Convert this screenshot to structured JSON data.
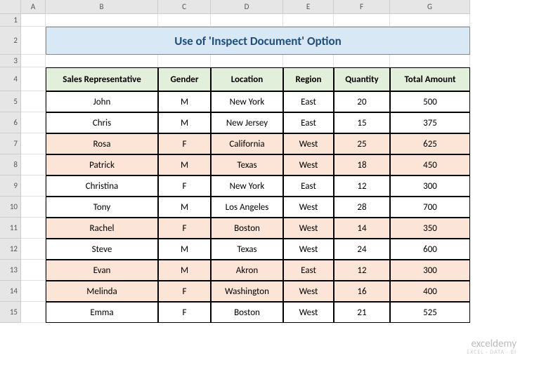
{
  "columns": [
    "A",
    "B",
    "C",
    "D",
    "E",
    "F",
    "G"
  ],
  "rows_visible": 15,
  "title": "Use of 'Inspect Document' Option",
  "chart_data": {
    "type": "table",
    "title": "Use of 'Inspect Document' Option",
    "headers": [
      "Sales Representative",
      "Gender",
      "Location",
      "Region",
      "Quantity",
      "Total Amount"
    ],
    "rows": [
      {
        "rep": "John",
        "gender": "M",
        "location": "New York",
        "region": "East",
        "quantity": 20,
        "total": 500,
        "highlight": false
      },
      {
        "rep": "Chris",
        "gender": "M",
        "location": "New Jersey",
        "region": "East",
        "quantity": 15,
        "total": 375,
        "highlight": false
      },
      {
        "rep": "Rosa",
        "gender": "F",
        "location": "California",
        "region": "West",
        "quantity": 25,
        "total": 625,
        "highlight": true
      },
      {
        "rep": "Patrick",
        "gender": "M",
        "location": "Texas",
        "region": "West",
        "quantity": 18,
        "total": 450,
        "highlight": true
      },
      {
        "rep": "Christina",
        "gender": "F",
        "location": "New York",
        "region": "East",
        "quantity": 12,
        "total": 300,
        "highlight": false
      },
      {
        "rep": "Tony",
        "gender": "M",
        "location": "Los Angeles",
        "region": "West",
        "quantity": 28,
        "total": 700,
        "highlight": false
      },
      {
        "rep": "Rachel",
        "gender": "F",
        "location": "Boston",
        "region": "West",
        "quantity": 14,
        "total": 350,
        "highlight": true
      },
      {
        "rep": "Steve",
        "gender": "M",
        "location": "Texas",
        "region": "West",
        "quantity": 24,
        "total": 600,
        "highlight": false
      },
      {
        "rep": "Evan",
        "gender": "M",
        "location": "Akron",
        "region": "East",
        "quantity": 12,
        "total": 300,
        "highlight": true
      },
      {
        "rep": "Melinda",
        "gender": "F",
        "location": "Washington",
        "region": "West",
        "quantity": 16,
        "total": 400,
        "highlight": true
      },
      {
        "rep": "Emma",
        "gender": "F",
        "location": "Boston",
        "region": "West",
        "quantity": 21,
        "total": 525,
        "highlight": false
      }
    ]
  },
  "watermark": {
    "brand": "exceldemy",
    "tag": "EXCEL · DATA · BI"
  }
}
